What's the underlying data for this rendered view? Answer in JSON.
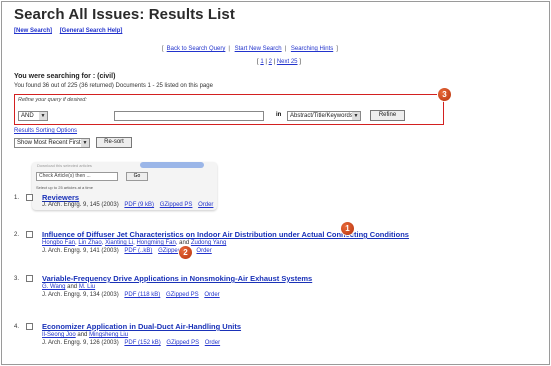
{
  "page": {
    "title": "Search All Issues: Results List",
    "top_links": [
      "[New Search]",
      "[General Search Help]"
    ],
    "center_links": [
      "Back to Search Query",
      "Start New Search",
      "Searching Hints"
    ],
    "pager": {
      "pages": [
        "1",
        "2"
      ],
      "next": "Next 25"
    },
    "searching_for": "You were searching for : (civil)",
    "found_text": "You found 36 out of 225 (36 returned)   Documents 1 - 25 listed on this page"
  },
  "refine": {
    "label": "Refine your query if desired:",
    "operator": "AND",
    "in_label": "in",
    "field": "Abstract/Title/Keywords",
    "button": "Refine"
  },
  "result_strings_link": "Results Sorting Options",
  "sort": {
    "option": "Show Most Recent First",
    "button": "Re-sort"
  },
  "widget": {
    "header": "Download this selected articles",
    "select": "Check Article(s) then ...",
    "go": "Go",
    "note": "Select up to 25 articles at a time"
  },
  "markers": {
    "m1": "1",
    "m2": "2",
    "m3": "3"
  },
  "results": [
    {
      "num": "1.",
      "title": "Reviewers",
      "authors": [],
      "cite": "J. Arch. Engrg. 9, 145 (2003)",
      "links": [
        "PDF (9 kB)",
        "GZipped PS",
        "Order"
      ]
    },
    {
      "num": "2.",
      "title": "Influence of Diffuser Jet Characteristics on Indoor Air Distribution under Actual Connecting Conditions",
      "authors": [
        "Hongbo Fan",
        "Lin Zhao",
        "Xianting Li",
        "Hongming Fan",
        "Zudong Yang"
      ],
      "cite": "J. Arch. Engrg. 9, 141 (2003)",
      "links": [
        "PDF (..kB)",
        "GZipped PS",
        "Order"
      ]
    },
    {
      "num": "3.",
      "title": "Variable-Frequency Drive Applications in Nonsmoking-Air Exhaust Systems",
      "authors": [
        "G. Wang",
        "M. Liu"
      ],
      "cite": "J. Arch. Engrg. 9, 134 (2003)",
      "links": [
        "PDF (118 kB)",
        "GZipped PS",
        "Order"
      ]
    },
    {
      "num": "4.",
      "title": "Economizer Application in Dual-Duct Air-Handling Units",
      "authors": [
        "Il-Seong Joo",
        "Mingsheng Liu"
      ],
      "cite": "J. Arch. Engrg. 9, 126 (2003)",
      "links": [
        "PDF (152 kB)",
        "GZipped PS",
        "Order"
      ]
    }
  ],
  "colors": {
    "link": "#2233cc",
    "title_link": "#1a32b8",
    "refine_border": "#d32020",
    "marker": "#c8431a"
  }
}
